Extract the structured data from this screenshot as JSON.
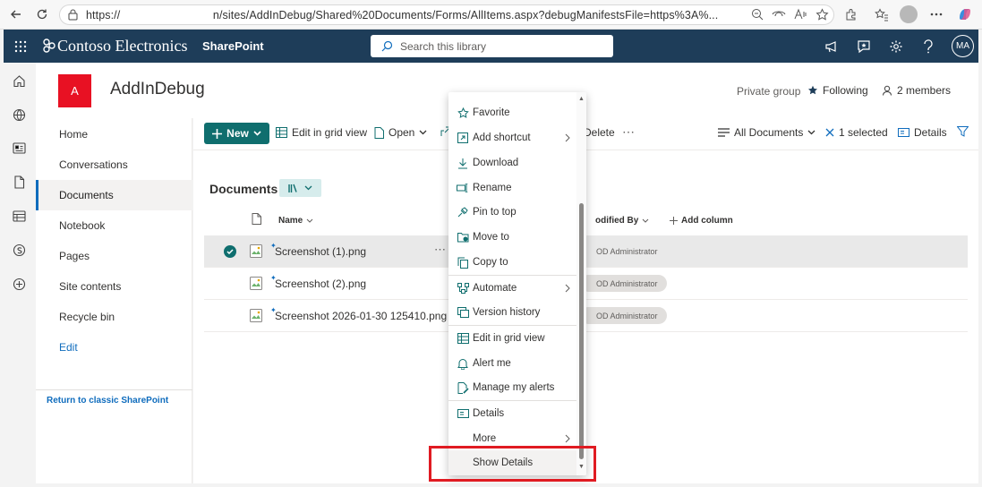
{
  "browser": {
    "url": "https://                             n/sites/AddInDebug/Shared%20Documents/Forms/AllItems.aspx?debugManifestsFile=https%3A%..."
  },
  "suite": {
    "brand": "Contoso Electronics",
    "app": "SharePoint",
    "search_placeholder": "Search this library",
    "avatar": "MA"
  },
  "site": {
    "logo_letter": "A",
    "title": "AddInDebug",
    "privacy": "Private group",
    "following": "Following",
    "members": "2 members"
  },
  "nav": {
    "items": [
      "Home",
      "Conversations",
      "Documents",
      "Notebook",
      "Pages",
      "Site contents",
      "Recycle bin"
    ],
    "edit": "Edit",
    "classic": "Return to classic SharePoint"
  },
  "commands": {
    "new": "New",
    "edit_grid": "Edit in grid view",
    "open": "Open",
    "delete": "Delete",
    "more": "⋯",
    "view": "All Documents",
    "selected": "1 selected",
    "details": "Details"
  },
  "library": {
    "title": "Documents",
    "columns": {
      "name": "Name",
      "modified_by": "odified By",
      "add_column": "Add column"
    },
    "rows": [
      {
        "name": "Screenshot (1).png",
        "modified_by": "OD Administrator",
        "selected": true
      },
      {
        "name": "Screenshot (2).png",
        "modified_by": "OD Administrator",
        "selected": false
      },
      {
        "name": "Screenshot 2026-01-30 125410.png",
        "modified_by": "OD Administrator",
        "selected": false
      }
    ]
  },
  "context_menu": {
    "items": [
      {
        "label": "Favorite",
        "icon": "star-icon"
      },
      {
        "label": "Add shortcut",
        "icon": "shortcut-icon",
        "submenu": true
      },
      {
        "label": "Download",
        "icon": "download-icon"
      },
      {
        "label": "Rename",
        "icon": "rename-icon"
      },
      {
        "label": "Pin to top",
        "icon": "pin-icon"
      },
      {
        "label": "Move to",
        "icon": "move-icon"
      },
      {
        "label": "Copy to",
        "icon": "copy-icon"
      },
      {
        "label": "Automate",
        "icon": "automate-icon",
        "submenu": true
      },
      {
        "label": "Version history",
        "icon": "history-icon"
      },
      {
        "label": "Edit in grid view",
        "icon": "grid-icon"
      },
      {
        "label": "Alert me",
        "icon": "bell-icon"
      },
      {
        "label": "Manage my alerts",
        "icon": "manage-alerts-icon"
      },
      {
        "label": "Details",
        "icon": "details-icon"
      },
      {
        "label": "More",
        "icon": "",
        "submenu": true
      },
      {
        "label": "Show Details",
        "icon": ""
      }
    ]
  },
  "colors": {
    "suite_bar": "#1e3d59",
    "accent": "#0f6e6e",
    "link": "#0f6cbd",
    "highlight_box": "#e01b22"
  }
}
